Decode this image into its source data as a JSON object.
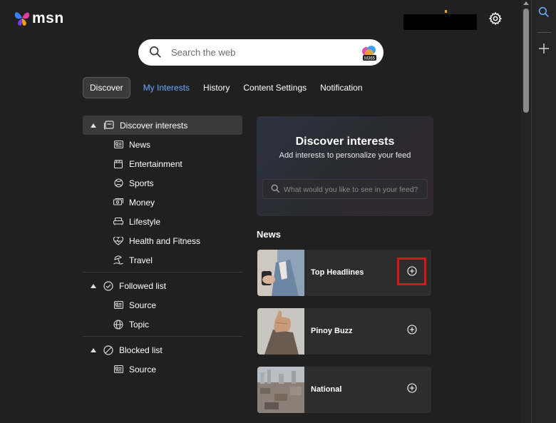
{
  "brand": {
    "name": "msn"
  },
  "search": {
    "placeholder": "Search the web",
    "copilot_badge": "M365"
  },
  "tabs": [
    {
      "label": "Discover"
    },
    {
      "label": "My Interests"
    },
    {
      "label": "History"
    },
    {
      "label": "Content Settings"
    },
    {
      "label": "Notification"
    }
  ],
  "tree": {
    "discover": {
      "label": "Discover interests",
      "items": [
        {
          "label": "News",
          "icon": "newspaper-icon"
        },
        {
          "label": "Entertainment",
          "icon": "clapperboard-icon"
        },
        {
          "label": "Sports",
          "icon": "ball-icon"
        },
        {
          "label": "Money",
          "icon": "money-icon"
        },
        {
          "label": "Lifestyle",
          "icon": "sofa-icon"
        },
        {
          "label": "Health and Fitness",
          "icon": "heart-pulse-icon"
        },
        {
          "label": "Travel",
          "icon": "beach-icon"
        }
      ]
    },
    "followed": {
      "label": "Followed list",
      "items": [
        {
          "label": "Source",
          "icon": "newspaper-icon"
        },
        {
          "label": "Topic",
          "icon": "globe-icon"
        }
      ]
    },
    "blocked": {
      "label": "Blocked list",
      "items": [
        {
          "label": "Source",
          "icon": "newspaper-icon"
        }
      ]
    }
  },
  "discover_card": {
    "title": "Discover interests",
    "subtitle": "Add interests to personalize your feed",
    "search_placeholder": "What would you like to see in your feed?"
  },
  "news_section": {
    "label": "News",
    "topics": [
      {
        "name": "Top Headlines"
      },
      {
        "name": "Pinoy Buzz"
      },
      {
        "name": "National"
      }
    ]
  },
  "colors": {
    "accent": "#6aa8ff",
    "highlight": "#d9141b",
    "background": "#202020"
  }
}
